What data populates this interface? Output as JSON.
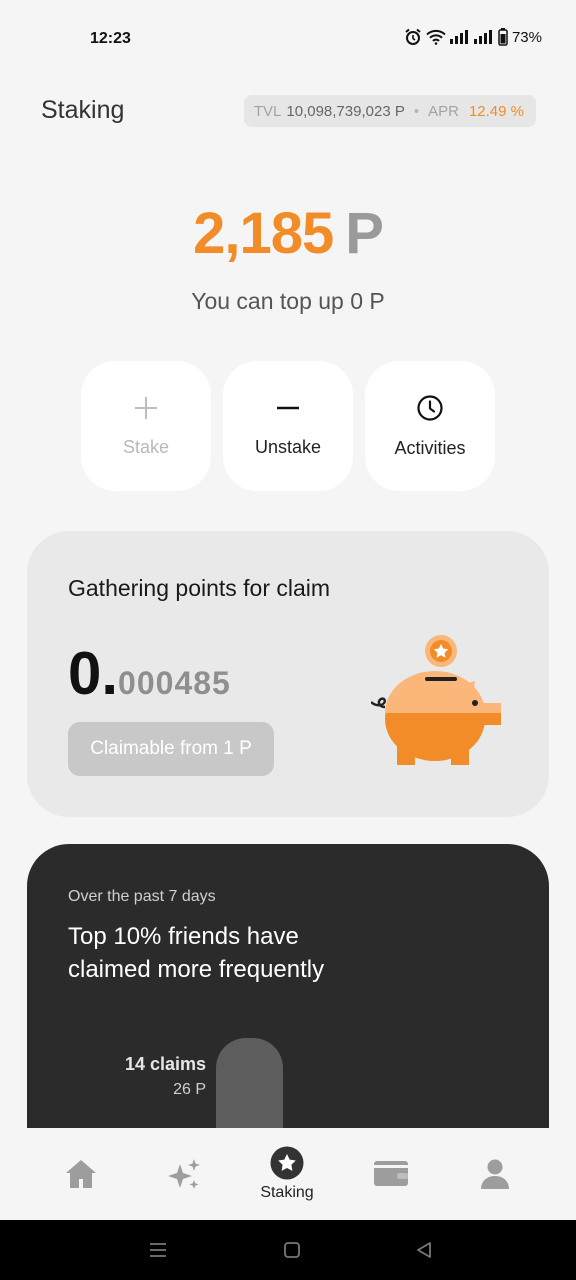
{
  "status_bar": {
    "time": "12:23",
    "battery": "73%"
  },
  "header": {
    "title": "Staking",
    "tvl_label": "TVL",
    "tvl_value": "10,098,739,023 P",
    "separator": "•",
    "apr_label": "APR",
    "apr_value": "12.49 %"
  },
  "balance": {
    "amount": "2,185",
    "unit": "P",
    "topup_text": "You can top up 0 P"
  },
  "actions": [
    {
      "label": "Stake",
      "icon": "plus-icon",
      "enabled": false
    },
    {
      "label": "Unstake",
      "icon": "minus-icon",
      "enabled": true
    },
    {
      "label": "Activities",
      "icon": "clock-icon",
      "enabled": true
    }
  ],
  "claim_card": {
    "title": "Gathering points for claim",
    "value_int": "0.",
    "value_dec": "000485",
    "button_label": "Claimable from 1 P",
    "illustration": "piggy-bank-icon"
  },
  "stats_card": {
    "subtitle": "Over the past 7 days",
    "headline_line1": "Top 10% friends have",
    "headline_line2": "claimed more frequently",
    "bar_claims": "14 claims",
    "bar_points": "26 P"
  },
  "bottom_nav": [
    {
      "label": "",
      "icon": "home-icon",
      "active": false
    },
    {
      "label": "",
      "icon": "sparkles-icon",
      "active": false
    },
    {
      "label": "Staking",
      "icon": "star-circle-icon",
      "active": true
    },
    {
      "label": "",
      "icon": "wallet-icon",
      "active": false
    },
    {
      "label": "",
      "icon": "person-icon",
      "active": false
    }
  ],
  "colors": {
    "accent": "#f28c28",
    "background": "#f5f5f5",
    "dark_card": "#2b2b2b"
  }
}
